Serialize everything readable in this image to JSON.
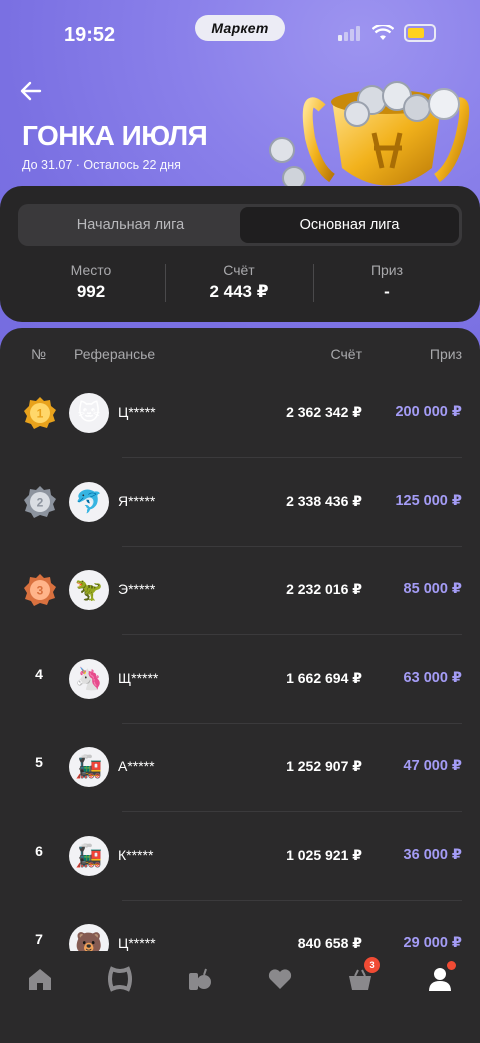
{
  "status": {
    "time": "19:52",
    "pill": "Маркет"
  },
  "header": {
    "title": "ГОНКА ИЮЛЯ",
    "subtitle": "До 31.07 · Осталось 22 дня"
  },
  "league": {
    "tabs": [
      {
        "label": "Начальная лига",
        "active": false
      },
      {
        "label": "Основная лига",
        "active": true
      }
    ],
    "stats": [
      {
        "label": "Место",
        "value": "992"
      },
      {
        "label": "Счёт",
        "value": "2 443 ₽"
      },
      {
        "label": "Приз",
        "value": "-"
      }
    ]
  },
  "table": {
    "headers": {
      "rank": "№",
      "user": "Реферансье",
      "score": "Счёт",
      "prize": "Приз"
    },
    "rows": [
      {
        "rank": "1",
        "medal": "gold",
        "avatar": "🐱",
        "name": "Ц*****",
        "score": "2 362 342 ₽",
        "prize": "200 000 ₽"
      },
      {
        "rank": "2",
        "medal": "silver",
        "avatar": "🐬",
        "name": "Я*****",
        "score": "2 338 436 ₽",
        "prize": "125 000 ₽"
      },
      {
        "rank": "3",
        "medal": "bronze",
        "avatar": "🦖",
        "name": "Э*****",
        "score": "2 232 016 ₽",
        "prize": "85 000 ₽"
      },
      {
        "rank": "4",
        "medal": "",
        "avatar": "🦄",
        "name": "Щ*****",
        "score": "1 662 694 ₽",
        "prize": "63 000 ₽"
      },
      {
        "rank": "5",
        "medal": "",
        "avatar": "🚂",
        "name": "А*****",
        "score": "1 252 907 ₽",
        "prize": "47 000 ₽"
      },
      {
        "rank": "6",
        "medal": "",
        "avatar": "🚂",
        "name": "К*****",
        "score": "1 025 921 ₽",
        "prize": "36 000 ₽"
      },
      {
        "rank": "7",
        "medal": "",
        "avatar": "🐻",
        "name": "Ц*****",
        "score": "840 658 ₽",
        "prize": "29 000 ₽"
      }
    ]
  },
  "tabbar": {
    "items": [
      "home-icon",
      "catalog-icon",
      "grocery-icon",
      "favorites-icon",
      "cart-icon",
      "profile-icon"
    ],
    "cart_badge": "3"
  },
  "colors": {
    "accent": "#a49cf5",
    "hero": "#7a70e2",
    "card": "#272627",
    "badge": "#f04b34"
  }
}
